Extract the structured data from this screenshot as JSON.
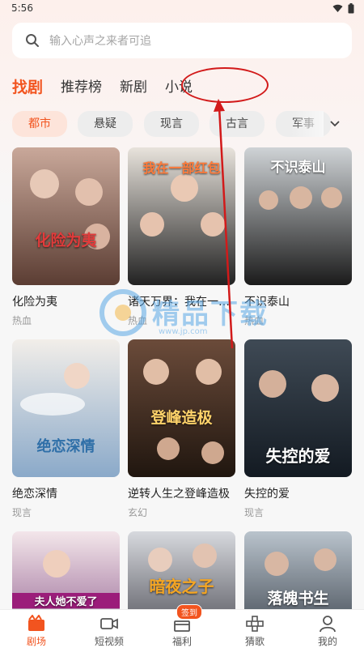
{
  "status_bar": {
    "time": "5:56"
  },
  "search": {
    "placeholder": "输入心声之来者可追"
  },
  "tabs": [
    {
      "label": "找剧",
      "active": true
    },
    {
      "label": "推荐榜",
      "active": false
    },
    {
      "label": "新剧",
      "active": false
    },
    {
      "label": "小说",
      "active": false
    }
  ],
  "chips": [
    {
      "label": "都市",
      "active": true
    },
    {
      "label": "悬疑",
      "active": false
    },
    {
      "label": "现言",
      "active": false
    },
    {
      "label": "古言",
      "active": false
    },
    {
      "label": "军事",
      "active": false
    }
  ],
  "cards": [
    {
      "title": "化险为夷",
      "tag": "热血",
      "cover_text": "化险为夷",
      "palette": [
        "#c9a89a",
        "#5b3d33"
      ]
    },
    {
      "title": "诸天万界：我在一部红包",
      "tag": "热血",
      "cover_text": "我在一部红包",
      "palette": [
        "#e8e3dc",
        "#222222"
      ]
    },
    {
      "title": "不识泰山",
      "tag": "热血",
      "cover_text": "不识泰山",
      "palette": [
        "#cfd3d6",
        "#1b1b1b"
      ]
    },
    {
      "title": "绝恋深情",
      "tag": "现言",
      "cover_text": "绝恋深情",
      "palette": [
        "#f2eee9",
        "#8aa9c9"
      ]
    },
    {
      "title": "逆转人生之登峰造极",
      "tag": "玄幻",
      "cover_text": "登峰造极",
      "palette": [
        "#6b4b3a",
        "#20160f"
      ]
    },
    {
      "title": "失控的爱",
      "tag": "现言",
      "cover_text": "失控的爱",
      "palette": [
        "#3f4a55",
        "#131a22"
      ]
    },
    {
      "title": "",
      "tag": "",
      "cover_text": "夫人她不爱了",
      "palette": [
        "#f3e6ea",
        "#7a3f7a"
      ]
    },
    {
      "title": "",
      "tag": "",
      "cover_text": "暗夜之子",
      "palette": [
        "#d7d9de",
        "#2a2a33"
      ]
    },
    {
      "title": "",
      "tag": "",
      "cover_text": "落魄书生",
      "palette": [
        "#b9c3cc",
        "#1f2630"
      ]
    }
  ],
  "watermark": {
    "text": "精品下载",
    "url": "www.jp.com"
  },
  "bottom_nav": [
    {
      "label": "剧场",
      "icon": "theater-icon",
      "active": true
    },
    {
      "label": "短视频",
      "icon": "video-camera-icon",
      "active": false
    },
    {
      "label": "福利",
      "icon": "gift-icon",
      "active": false,
      "badge": "签到"
    },
    {
      "label": "猜歌",
      "icon": "game-controller-icon",
      "active": false
    },
    {
      "label": "我的",
      "icon": "user-icon",
      "active": false
    }
  ],
  "colors": {
    "accent": "#f2541f",
    "annotation": "#d21a1a"
  }
}
